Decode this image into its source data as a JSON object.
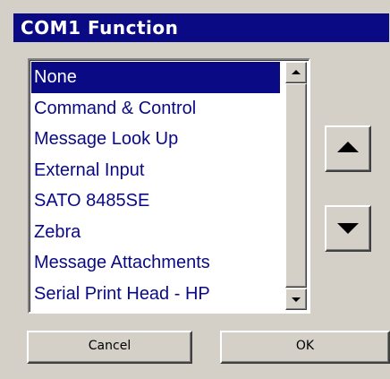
{
  "dialog": {
    "title": "COM1 Function"
  },
  "list": {
    "selected_index": 0,
    "items": [
      {
        "label": "None"
      },
      {
        "label": "Command & Control"
      },
      {
        "label": "Message Look Up"
      },
      {
        "label": "External Input"
      },
      {
        "label": "SATO 8485SE"
      },
      {
        "label": "Zebra"
      },
      {
        "label": "Message Attachments"
      },
      {
        "label": "Serial Print Head - HP"
      }
    ]
  },
  "buttons": {
    "cancel_label": "Cancel",
    "ok_label": "OK"
  },
  "icons": {
    "scroll_up": "triangle-up",
    "scroll_down": "triangle-down",
    "move_up": "triangle-up",
    "move_down": "triangle-down"
  },
  "colors": {
    "title_bar": "#0a0a84",
    "list_text": "#0a0a84",
    "selection_bg": "#0a0a84",
    "dialog_bg": "#d4d0c8"
  }
}
